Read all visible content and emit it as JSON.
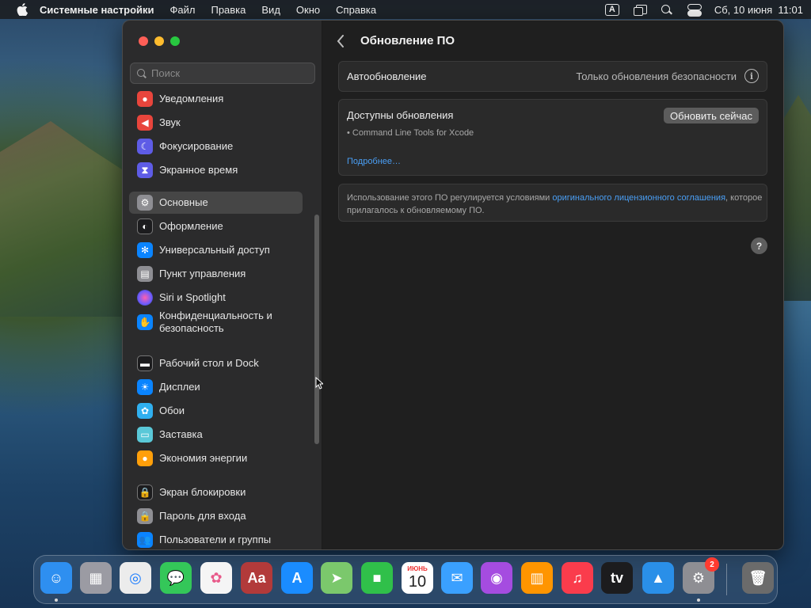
{
  "menubar": {
    "app_name": "Системные настройки",
    "items": [
      "Файл",
      "Правка",
      "Вид",
      "Окно",
      "Справка"
    ],
    "input_indicator": "A",
    "datetime": "Сб, 10 июня  11:01"
  },
  "sidebar": {
    "search_placeholder": "Поиск",
    "items": [
      {
        "label": "Уведомления",
        "icon": "bell-icon",
        "color": "#e8453c"
      },
      {
        "label": "Звук",
        "icon": "speaker-icon",
        "color": "#e8453c"
      },
      {
        "label": "Фокусирование",
        "icon": "moon-icon",
        "color": "#5e5ce6"
      },
      {
        "label": "Экранное время",
        "icon": "hourglass-icon",
        "color": "#5e5ce6"
      },
      {
        "label": "Основные",
        "icon": "gear-icon",
        "color": "#8e8e93"
      },
      {
        "label": "Оформление",
        "icon": "appearance-icon",
        "color": "#1c1c1e"
      },
      {
        "label": "Универсальный доступ",
        "icon": "accessibility-icon",
        "color": "#0a84ff"
      },
      {
        "label": "Пункт управления",
        "icon": "control-center-icon",
        "color": "#8e8e93"
      },
      {
        "label": "Siri и Spotlight",
        "icon": "siri-icon",
        "color": "#bf5af2"
      },
      {
        "label": "Конфиденциальность и безопасность",
        "icon": "hand-icon",
        "color": "#0a84ff"
      },
      {
        "label": "Рабочий стол и Dock",
        "icon": "dock-icon",
        "color": "#1c1c1e"
      },
      {
        "label": "Дисплеи",
        "icon": "sun-icon",
        "color": "#0a84ff"
      },
      {
        "label": "Обои",
        "icon": "flower-icon",
        "color": "#30b0f0"
      },
      {
        "label": "Заставка",
        "icon": "screensaver-icon",
        "color": "#5ac8d8"
      },
      {
        "label": "Экономия энергии",
        "icon": "bulb-icon",
        "color": "#ff9f0a"
      },
      {
        "label": "Экран блокировки",
        "icon": "lock-icon",
        "color": "#1c1c1e"
      },
      {
        "label": "Пароль для входа",
        "icon": "padlock-icon",
        "color": "#8e8e93"
      },
      {
        "label": "Пользователи и группы",
        "icon": "users-icon",
        "color": "#0a84ff"
      }
    ]
  },
  "content": {
    "title": "Обновление ПО",
    "auto_update": {
      "label": "Автообновление",
      "value": "Только обновления безопасности"
    },
    "updates": {
      "heading": "Доступны обновления",
      "package": "• Command Line Tools for Xcode",
      "more_link": "Подробнее…",
      "update_button": "Обновить сейчас"
    },
    "license": {
      "text_before": "Использование этого ПО регулируется условиями ",
      "link": "оригинального лицензионного соглашения",
      "text_after": ", которое прилагалось к обновляемому ПО."
    },
    "help": "?"
  },
  "dock": {
    "apps": [
      {
        "name": "finder-icon",
        "color": "#2e8ff0",
        "glyph": "☺"
      },
      {
        "name": "launchpad-icon",
        "color": "#9b9ba3",
        "glyph": "▦"
      },
      {
        "name": "safari-icon",
        "color": "#ececec",
        "glyph": "◎"
      },
      {
        "name": "messages-icon",
        "color": "#34c759",
        "glyph": "💬"
      },
      {
        "name": "photos-icon",
        "color": "#f5f5f5",
        "glyph": "✿"
      },
      {
        "name": "dictionary-icon",
        "color": "#b23a3a",
        "glyph": "Aa"
      },
      {
        "name": "app-store-icon",
        "color": "#1a8cff",
        "glyph": "A"
      },
      {
        "name": "maps-icon",
        "color": "#7bc86c",
        "glyph": "➤"
      },
      {
        "name": "facetime-icon",
        "color": "#30c04a",
        "glyph": "■"
      },
      {
        "name": "calendar-icon",
        "color": "#ffffff",
        "glyph": "10"
      },
      {
        "name": "mail-icon",
        "color": "#3aa0ff",
        "glyph": "✉"
      },
      {
        "name": "podcasts-icon",
        "color": "#a54ce0",
        "glyph": "◉"
      },
      {
        "name": "books-icon",
        "color": "#ff9500",
        "glyph": "▥"
      },
      {
        "name": "music-icon",
        "color": "#fa3c4c",
        "glyph": "♫"
      },
      {
        "name": "tv-icon",
        "color": "#1c1c1e",
        "glyph": "tv"
      },
      {
        "name": "keynote-icon",
        "color": "#2a8fe8",
        "glyph": "▲"
      },
      {
        "name": "system-settings-icon",
        "color": "#8e8e93",
        "glyph": "⚙"
      },
      {
        "name": "trash-icon",
        "color": "#6b6b6b",
        "glyph": "🗑"
      }
    ],
    "calendar_month": "ИЮНЬ",
    "settings_badge": "2"
  }
}
